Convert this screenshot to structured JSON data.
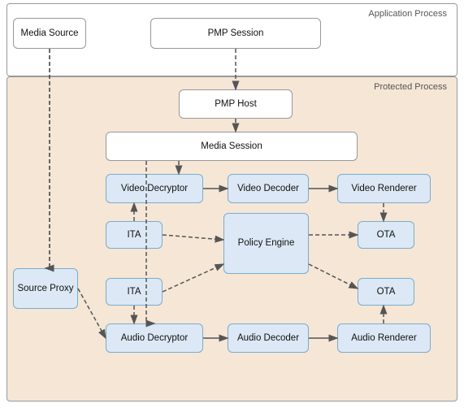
{
  "labels": {
    "app_process": "Application Process",
    "protected_process": "Protected Process",
    "media_source": "Media Source",
    "pmp_session": "PMP Session",
    "pmp_host": "PMP Host",
    "media_session": "Media Session",
    "video_decryptor": "Video Decryptor",
    "video_decoder": "Video Decoder",
    "video_renderer": "Video Renderer",
    "ita_top": "ITA",
    "policy_engine": "Policy Engine",
    "ota_top": "OTA",
    "ita_bottom": "ITA",
    "ota_bottom": "OTA",
    "audio_decryptor": "Audio Decryptor",
    "audio_decoder": "Audio Decoder",
    "audio_renderer": "Audio Renderer",
    "source_proxy": "Source Proxy"
  },
  "colors": {
    "box_fill": "#dce8f5",
    "box_border": "#7aadcc",
    "white_fill": "#ffffff",
    "protected_bg": "#f5e6d6",
    "arrow": "#555555",
    "label_text": "#555555"
  }
}
